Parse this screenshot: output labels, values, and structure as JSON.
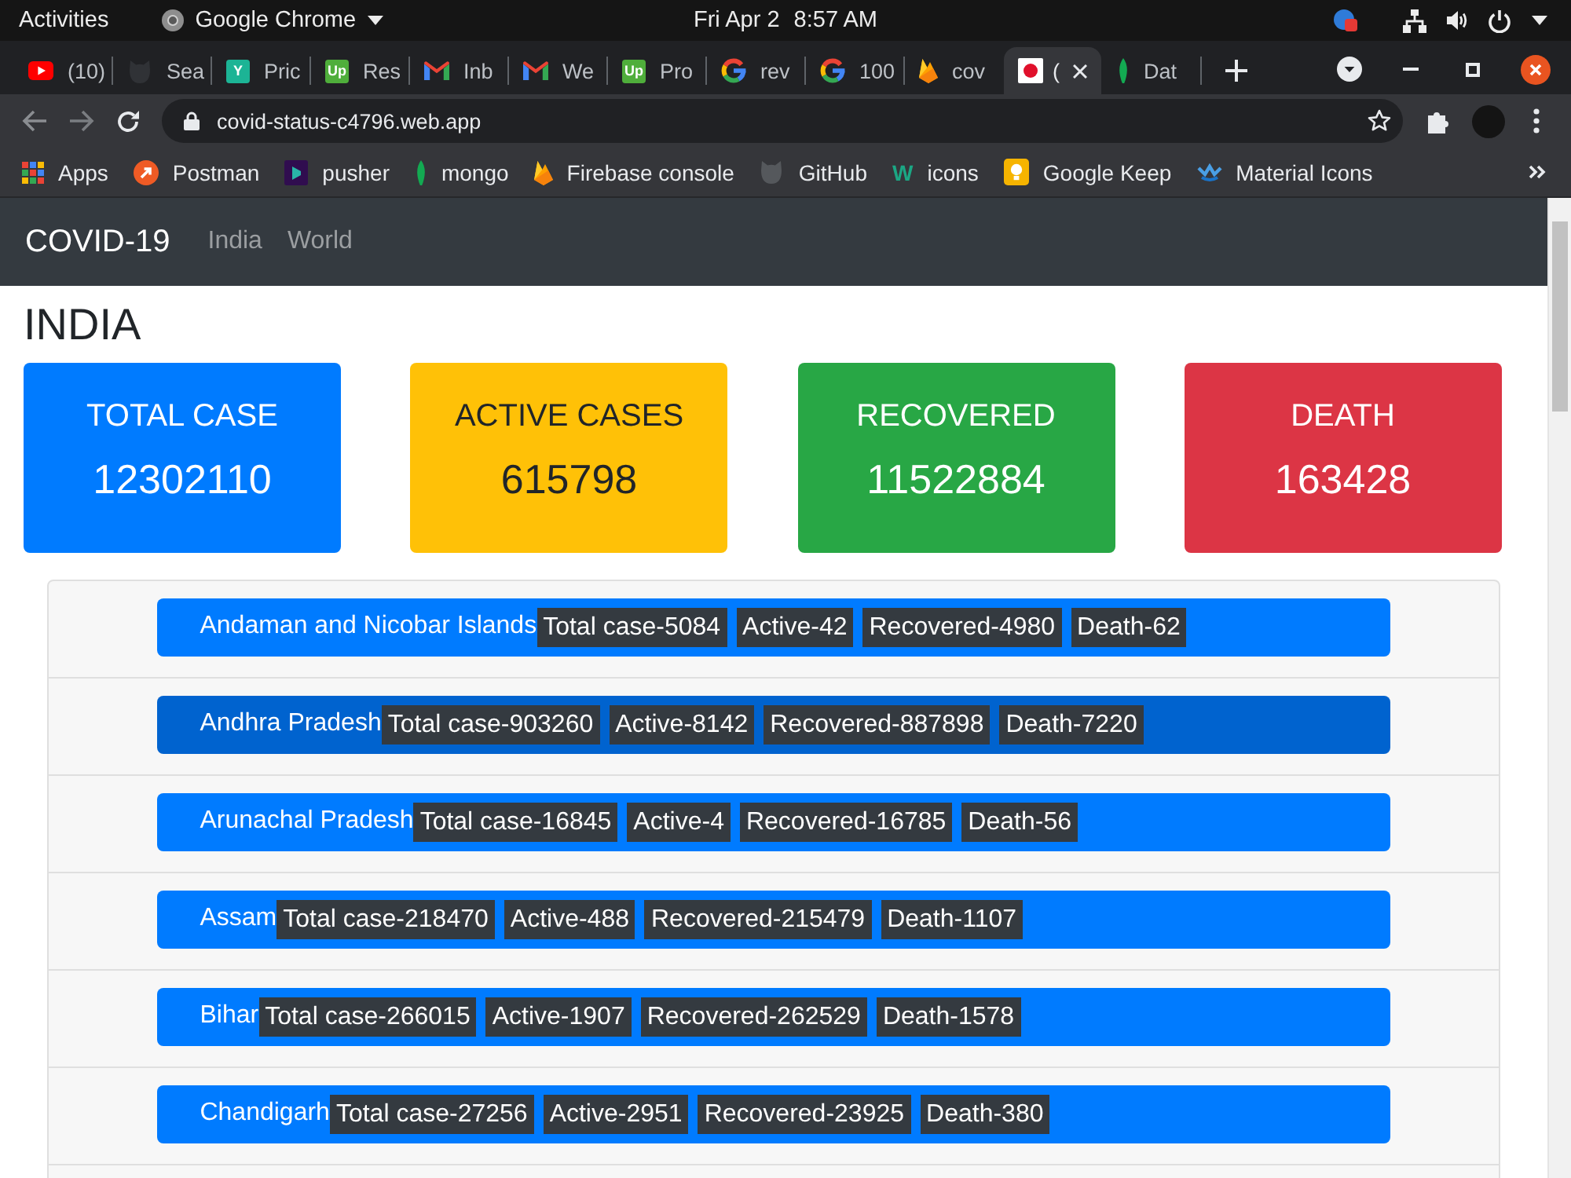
{
  "system_bar": {
    "activities": "Activities",
    "app_name": "Google Chrome",
    "date": "Fri Apr 2",
    "time": "8:57 AM"
  },
  "tabs": [
    {
      "kind": "play",
      "title": "(10)",
      "selected": false
    },
    {
      "kind": "cat",
      "title": "Sea",
      "selected": false
    },
    {
      "kind": "tile",
      "badge": "Y",
      "color": "#1cb495",
      "title": "Pric",
      "selected": false
    },
    {
      "kind": "tile",
      "badge": "Up",
      "color": "#4fae3b",
      "title": "Res",
      "selected": false
    },
    {
      "kind": "mail",
      "title": "Inb",
      "selected": false
    },
    {
      "kind": "mail",
      "title": "We",
      "selected": false
    },
    {
      "kind": "tile",
      "badge": "Up",
      "color": "#4fae3b",
      "title": "Pro",
      "selected": false
    },
    {
      "kind": "ring",
      "title": "rev",
      "selected": false
    },
    {
      "kind": "ring",
      "title": "100",
      "selected": false
    },
    {
      "kind": "flame",
      "title": "cov",
      "selected": false
    },
    {
      "kind": "dot",
      "title": "(",
      "selected": true
    },
    {
      "kind": "leaf",
      "title": "Dat",
      "selected": false
    }
  ],
  "address_bar": {
    "url": "covid-status-c4796.web.app"
  },
  "bookmarks": [
    {
      "kind": "grid",
      "label": "Apps"
    },
    {
      "kind": "arrow",
      "label": "Postman"
    },
    {
      "kind": "square",
      "label": "pusher"
    },
    {
      "kind": "leaf",
      "label": "mongo"
    },
    {
      "kind": "flame",
      "label": "Firebase console"
    },
    {
      "kind": "cat",
      "label": "GitHub"
    },
    {
      "kind": "letter",
      "badge": "W",
      "label": "icons"
    },
    {
      "kind": "bulb",
      "label": "Google Keep"
    },
    {
      "kind": "wave",
      "label": "Material Icons"
    }
  ],
  "navbar": {
    "brand": "COVID-19",
    "links": [
      "India",
      "World"
    ]
  },
  "heading": "INDIA",
  "stat_cards": [
    {
      "title": "TOTAL CASE",
      "value": "12302110",
      "color": "#007bff"
    },
    {
      "title": "ACTIVE CASES",
      "value": "615798",
      "color": "#ffc107"
    },
    {
      "title": "RECOVERED",
      "value": "11522884",
      "color": "#28a745"
    },
    {
      "title": "DEATH",
      "value": "163428",
      "color": "#dc3545"
    }
  ],
  "states": [
    {
      "name": "Andaman and Nicobar Islands",
      "selected": false,
      "stats": [
        "Total case-5084",
        "Active-42",
        "Recovered-4980",
        "Death-62"
      ]
    },
    {
      "name": "Andhra Pradesh",
      "selected": true,
      "stats": [
        "Total case-903260",
        "Active-8142",
        "Recovered-887898",
        "Death-7220"
      ]
    },
    {
      "name": "Arunachal Pradesh",
      "selected": false,
      "stats": [
        "Total case-16845",
        "Active-4",
        "Recovered-16785",
        "Death-56"
      ]
    },
    {
      "name": "Assam",
      "selected": false,
      "stats": [
        "Total case-218470",
        "Active-488",
        "Recovered-215479",
        "Death-1107"
      ]
    },
    {
      "name": "Bihar",
      "selected": false,
      "stats": [
        "Total case-266015",
        "Active-1907",
        "Recovered-262529",
        "Death-1578"
      ]
    },
    {
      "name": "Chandigarh",
      "selected": false,
      "stats": [
        "Total case-27256",
        "Active-2951",
        "Recovered-23925",
        "Death-380"
      ]
    }
  ]
}
